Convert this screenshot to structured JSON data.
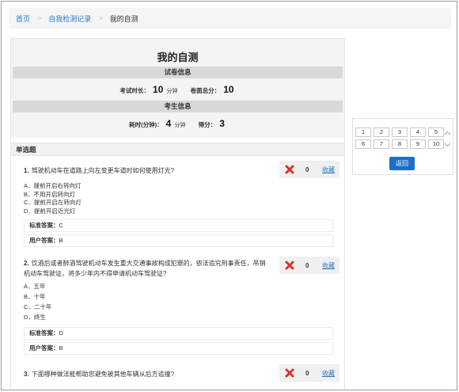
{
  "breadcrumb": {
    "home": "首页",
    "records": "自我检测记录",
    "current": "我的自测"
  },
  "title": "我的自测",
  "paper_info": {
    "header": "试卷信息",
    "duration_label": "考试时长：",
    "duration_value": "10",
    "duration_unit": "分钟",
    "total_label": "卷面总分：",
    "total_value": "10"
  },
  "candidate_info": {
    "header": "考生信息",
    "time_label": "耗时(分钟)：",
    "time_value": "4",
    "time_unit": "分钟",
    "score_label": "得分：",
    "score_value": "3"
  },
  "section_type": "单选题",
  "questions": [
    {
      "num": "1.",
      "text": "驾驶机动车在道路上向左变更车道时如何使用灯光?",
      "options": [
        "A．提前开启右转向灯",
        "B．不用开启转向灯",
        "C．提前开启左转向灯",
        "D．提前开启近光灯"
      ],
      "score": "0",
      "collect": "收藏",
      "standard_label": "标准答案：",
      "standard": "C",
      "user_label": "用户答案：",
      "user": "B"
    },
    {
      "num": "2.",
      "text": "饮酒后或者醉酒驾驶机动车发生重大交通事故构成犯罪的，依法追究刑事责任，吊销机动车驾驶证，将多少年内不得申请机动车驾驶证?",
      "options": [
        "A．五年",
        "B．十年",
        "C．二十年",
        "D．终生"
      ],
      "score": "0",
      "collect": "收藏",
      "standard_label": "标准答案：",
      "standard": "D",
      "user_label": "用户答案：",
      "user": "B"
    },
    {
      "num": "3.",
      "text": "下面哪种做法能帮助您避免被其他车辆从后方追撞?",
      "score": "0",
      "collect": "收藏"
    }
  ],
  "navigator": {
    "numbers": [
      "1",
      "2",
      "3",
      "4",
      "5",
      "6",
      "7",
      "8",
      "9",
      "10"
    ],
    "back_label": "返回"
  },
  "colors": {
    "link": "#2a7ac0",
    "wrong": "#d9342b",
    "button": "#1a6fc9"
  }
}
